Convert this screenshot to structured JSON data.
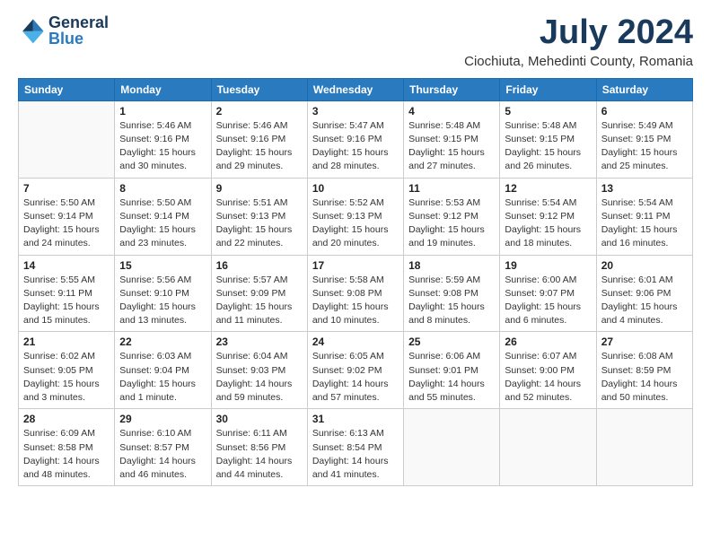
{
  "logo": {
    "general": "General",
    "blue": "Blue"
  },
  "title": "July 2024",
  "location": "Ciochiuta, Mehedinti County, Romania",
  "days_of_week": [
    "Sunday",
    "Monday",
    "Tuesday",
    "Wednesday",
    "Thursday",
    "Friday",
    "Saturday"
  ],
  "weeks": [
    [
      {
        "day": "",
        "info": ""
      },
      {
        "day": "1",
        "info": "Sunrise: 5:46 AM\nSunset: 9:16 PM\nDaylight: 15 hours\nand 30 minutes."
      },
      {
        "day": "2",
        "info": "Sunrise: 5:46 AM\nSunset: 9:16 PM\nDaylight: 15 hours\nand 29 minutes."
      },
      {
        "day": "3",
        "info": "Sunrise: 5:47 AM\nSunset: 9:16 PM\nDaylight: 15 hours\nand 28 minutes."
      },
      {
        "day": "4",
        "info": "Sunrise: 5:48 AM\nSunset: 9:15 PM\nDaylight: 15 hours\nand 27 minutes."
      },
      {
        "day": "5",
        "info": "Sunrise: 5:48 AM\nSunset: 9:15 PM\nDaylight: 15 hours\nand 26 minutes."
      },
      {
        "day": "6",
        "info": "Sunrise: 5:49 AM\nSunset: 9:15 PM\nDaylight: 15 hours\nand 25 minutes."
      }
    ],
    [
      {
        "day": "7",
        "info": "Sunrise: 5:50 AM\nSunset: 9:14 PM\nDaylight: 15 hours\nand 24 minutes."
      },
      {
        "day": "8",
        "info": "Sunrise: 5:50 AM\nSunset: 9:14 PM\nDaylight: 15 hours\nand 23 minutes."
      },
      {
        "day": "9",
        "info": "Sunrise: 5:51 AM\nSunset: 9:13 PM\nDaylight: 15 hours\nand 22 minutes."
      },
      {
        "day": "10",
        "info": "Sunrise: 5:52 AM\nSunset: 9:13 PM\nDaylight: 15 hours\nand 20 minutes."
      },
      {
        "day": "11",
        "info": "Sunrise: 5:53 AM\nSunset: 9:12 PM\nDaylight: 15 hours\nand 19 minutes."
      },
      {
        "day": "12",
        "info": "Sunrise: 5:54 AM\nSunset: 9:12 PM\nDaylight: 15 hours\nand 18 minutes."
      },
      {
        "day": "13",
        "info": "Sunrise: 5:54 AM\nSunset: 9:11 PM\nDaylight: 15 hours\nand 16 minutes."
      }
    ],
    [
      {
        "day": "14",
        "info": "Sunrise: 5:55 AM\nSunset: 9:11 PM\nDaylight: 15 hours\nand 15 minutes."
      },
      {
        "day": "15",
        "info": "Sunrise: 5:56 AM\nSunset: 9:10 PM\nDaylight: 15 hours\nand 13 minutes."
      },
      {
        "day": "16",
        "info": "Sunrise: 5:57 AM\nSunset: 9:09 PM\nDaylight: 15 hours\nand 11 minutes."
      },
      {
        "day": "17",
        "info": "Sunrise: 5:58 AM\nSunset: 9:08 PM\nDaylight: 15 hours\nand 10 minutes."
      },
      {
        "day": "18",
        "info": "Sunrise: 5:59 AM\nSunset: 9:08 PM\nDaylight: 15 hours\nand 8 minutes."
      },
      {
        "day": "19",
        "info": "Sunrise: 6:00 AM\nSunset: 9:07 PM\nDaylight: 15 hours\nand 6 minutes."
      },
      {
        "day": "20",
        "info": "Sunrise: 6:01 AM\nSunset: 9:06 PM\nDaylight: 15 hours\nand 4 minutes."
      }
    ],
    [
      {
        "day": "21",
        "info": "Sunrise: 6:02 AM\nSunset: 9:05 PM\nDaylight: 15 hours\nand 3 minutes."
      },
      {
        "day": "22",
        "info": "Sunrise: 6:03 AM\nSunset: 9:04 PM\nDaylight: 15 hours\nand 1 minute."
      },
      {
        "day": "23",
        "info": "Sunrise: 6:04 AM\nSunset: 9:03 PM\nDaylight: 14 hours\nand 59 minutes."
      },
      {
        "day": "24",
        "info": "Sunrise: 6:05 AM\nSunset: 9:02 PM\nDaylight: 14 hours\nand 57 minutes."
      },
      {
        "day": "25",
        "info": "Sunrise: 6:06 AM\nSunset: 9:01 PM\nDaylight: 14 hours\nand 55 minutes."
      },
      {
        "day": "26",
        "info": "Sunrise: 6:07 AM\nSunset: 9:00 PM\nDaylight: 14 hours\nand 52 minutes."
      },
      {
        "day": "27",
        "info": "Sunrise: 6:08 AM\nSunset: 8:59 PM\nDaylight: 14 hours\nand 50 minutes."
      }
    ],
    [
      {
        "day": "28",
        "info": "Sunrise: 6:09 AM\nSunset: 8:58 PM\nDaylight: 14 hours\nand 48 minutes."
      },
      {
        "day": "29",
        "info": "Sunrise: 6:10 AM\nSunset: 8:57 PM\nDaylight: 14 hours\nand 46 minutes."
      },
      {
        "day": "30",
        "info": "Sunrise: 6:11 AM\nSunset: 8:56 PM\nDaylight: 14 hours\nand 44 minutes."
      },
      {
        "day": "31",
        "info": "Sunrise: 6:13 AM\nSunset: 8:54 PM\nDaylight: 14 hours\nand 41 minutes."
      },
      {
        "day": "",
        "info": ""
      },
      {
        "day": "",
        "info": ""
      },
      {
        "day": "",
        "info": ""
      }
    ]
  ]
}
